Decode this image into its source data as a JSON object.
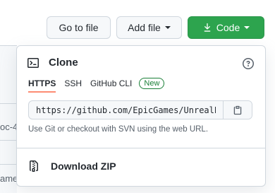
{
  "background": {
    "row1_text": "oc-4",
    "row2_text": "ame"
  },
  "toolbar": {
    "goto_label": "Go to file",
    "addfile_label": "Add file",
    "code_label": "Code",
    "code_color": "#2da44e"
  },
  "clone_panel": {
    "title": "Clone",
    "tabs": [
      {
        "label": "HTTPS",
        "active": true
      },
      {
        "label": "SSH",
        "active": false
      },
      {
        "label": "GitHub CLI",
        "active": false
      }
    ],
    "new_badge": "New",
    "url_value": "https://github.com/EpicGames/UnrealE",
    "hint": "Use Git or checkout with SVN using the web URL.",
    "download_label": "Download ZIP",
    "active_tab_underline_color": "#fd8c73",
    "new_badge_color": "#1a7f37"
  },
  "icons": {
    "terminal": "terminal-icon",
    "help": "question-circle-icon",
    "copy": "clipboard-icon",
    "zip": "file-zip-icon",
    "download": "download-icon"
  }
}
